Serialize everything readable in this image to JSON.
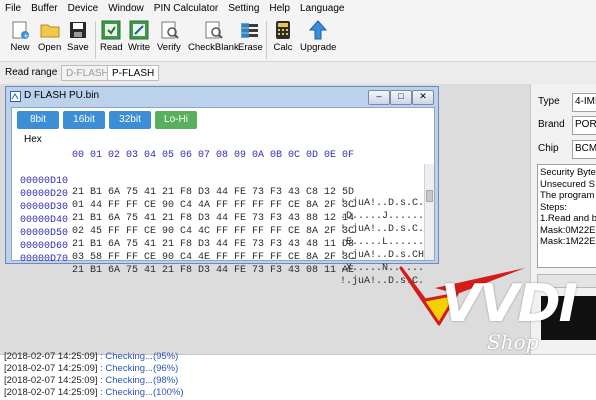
{
  "menu": [
    "File",
    "Buffer",
    "Device",
    "Window",
    "PIN Calculator",
    "Setting",
    "Help",
    "Language"
  ],
  "toolbar": {
    "new": "New",
    "open": "Open",
    "save": "Save",
    "read": "Read",
    "write": "Write",
    "verify": "Verify",
    "checkblank": "CheckBlank",
    "erase": "Erase",
    "calc": "Calc",
    "upgrade": "Upgrade"
  },
  "read_range": {
    "label": "Read range",
    "tabs": [
      "D-FLASH",
      "P-FLASH"
    ],
    "active": "P-FLASH"
  },
  "dialog": {
    "title": "D FLASH PU.bin",
    "bit_tabs": [
      "8bit",
      "16bit",
      "32bit",
      "Lo-Hi"
    ],
    "hex_label": "Hex",
    "hex_header": "00 01 02 03 04 05 06 07 08 09 0A 0B 0C 0D 0E 0F",
    "rows": [
      {
        "addr": "00000D10",
        "bytes": "21 B1 6A 75 41 21 F8 D3 44 FE 73 F3 43 C8 12 5D",
        "ascii": "!.juA!..D.s.C."
      },
      {
        "addr": "00000D20",
        "bytes": "01 44 FF FF CE 90 C4 4A FF FF FF FF CE 8A 2F 3C",
        "ascii": ".D.....J......"
      },
      {
        "addr": "00000D30",
        "bytes": "21 B1 6A 75 41 21 F8 D3 44 FE 73 F3 43 88 12 14",
        "ascii": "!.juA!..D.s.C."
      },
      {
        "addr": "00000D40",
        "bytes": "02 45 FF FF CE 90 C4 4C FF FF FF FF CE 8A 2F 3C",
        "ascii": ".E.....L......"
      },
      {
        "addr": "00000D50",
        "bytes": "21 B1 6A 75 41 21 F8 D3 44 FE 73 F3 43 48 11 D8",
        "ascii": "!.juA!..D.s.CH"
      },
      {
        "addr": "00000D60",
        "bytes": "03 58 FF FF CE 90 C4 4E FF FF FF FF CE 8A 2F 3C",
        "ascii": ".X.....N......"
      },
      {
        "addr": "00000D70",
        "bytes": "21 B1 6A 75 41 21 F8 D3 44 FE 73 F3 43 08 11 AE",
        "ascii": "!.juA!..D.s.C."
      }
    ]
  },
  "right_panel": {
    "type_label": "Type",
    "type_value": "4-IMM",
    "brand_label": "Brand",
    "brand_value": "POR",
    "chip_label": "Chip",
    "chip_value": "BCM",
    "info_lines": [
      "Security Byte",
      "Unsecured S",
      "The program",
      "Steps:",
      "1.Read and b",
      "Mask:0M22E",
      "Mask:1M22E"
    ]
  },
  "watermark": {
    "text": "VVDI",
    "sub": "Shop"
  },
  "log": [
    {
      "ts": "[2018-02-07 14:25:09]",
      "msg": " : Checking...(95%)"
    },
    {
      "ts": "[2018-02-07 14:25:09]",
      "msg": " : Checking...(96%)"
    },
    {
      "ts": "[2018-02-07 14:25:09]",
      "msg": " : Checking...(98%)"
    },
    {
      "ts": "[2018-02-07 14:25:09]",
      "msg": " : Checking...(100%)"
    }
  ],
  "colors": {
    "tab_blue": "#3c8fd6",
    "tab_green": "#58b05c",
    "hex_blue": "#2e2eb4",
    "log_blue": "#2c55b8",
    "watermark_yellow": "#f5d000"
  }
}
